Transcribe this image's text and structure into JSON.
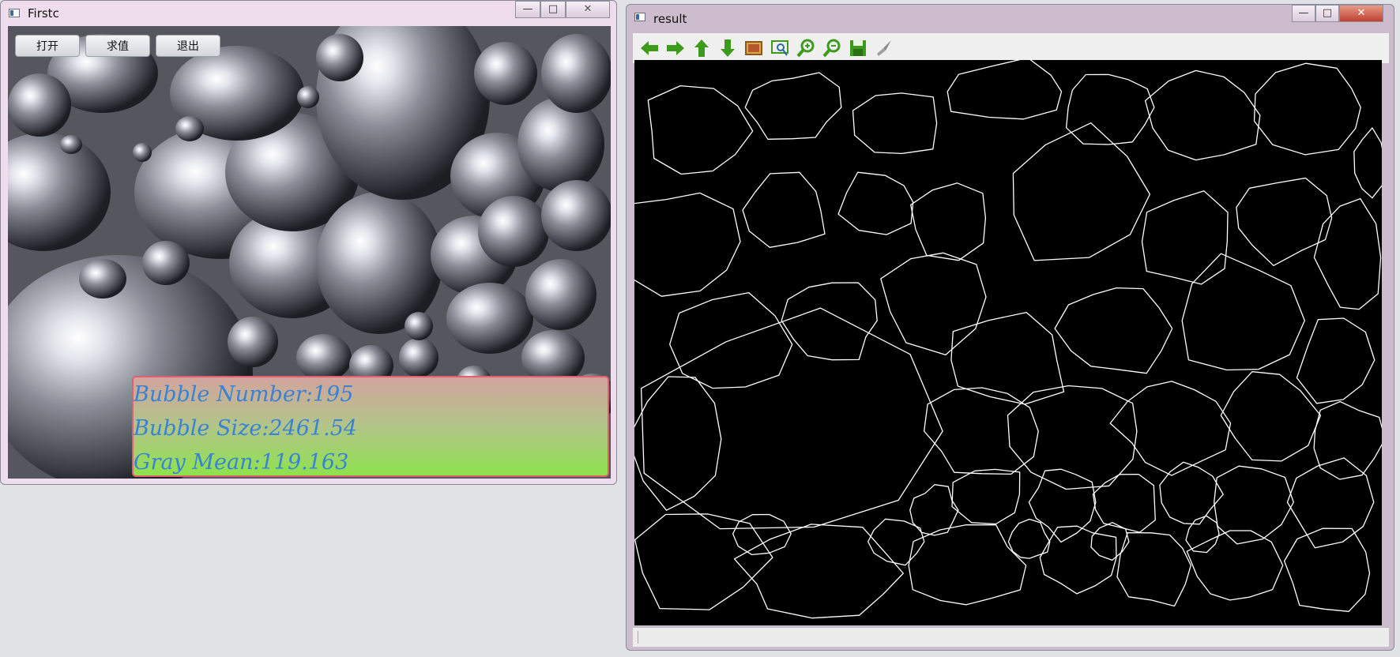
{
  "windows": {
    "first": {
      "title": "Firstc",
      "buttons": {
        "open": "打开",
        "compute": "求值",
        "exit": "退出"
      },
      "results": {
        "bubble_number": "Bubble Number:195",
        "bubble_size": "Bubble Size:2461.54",
        "gray_mean": "Gray Mean:119.163"
      }
    },
    "result": {
      "title": "result",
      "toolbar": [
        "arrow-left-icon",
        "arrow-right-icon",
        "arrow-up-icon",
        "arrow-down-icon",
        "image-icon",
        "zoom-fit-icon",
        "zoom-in-icon",
        "zoom-out-icon",
        "save-icon",
        "brush-icon"
      ]
    }
  },
  "window_controls": {
    "minimize": "—",
    "maximize": "□",
    "close": "✕"
  },
  "colors": {
    "accent_text": "#3a82d4",
    "panel_border": "#e06070",
    "toolbar_icon": "#3e9a1c"
  }
}
